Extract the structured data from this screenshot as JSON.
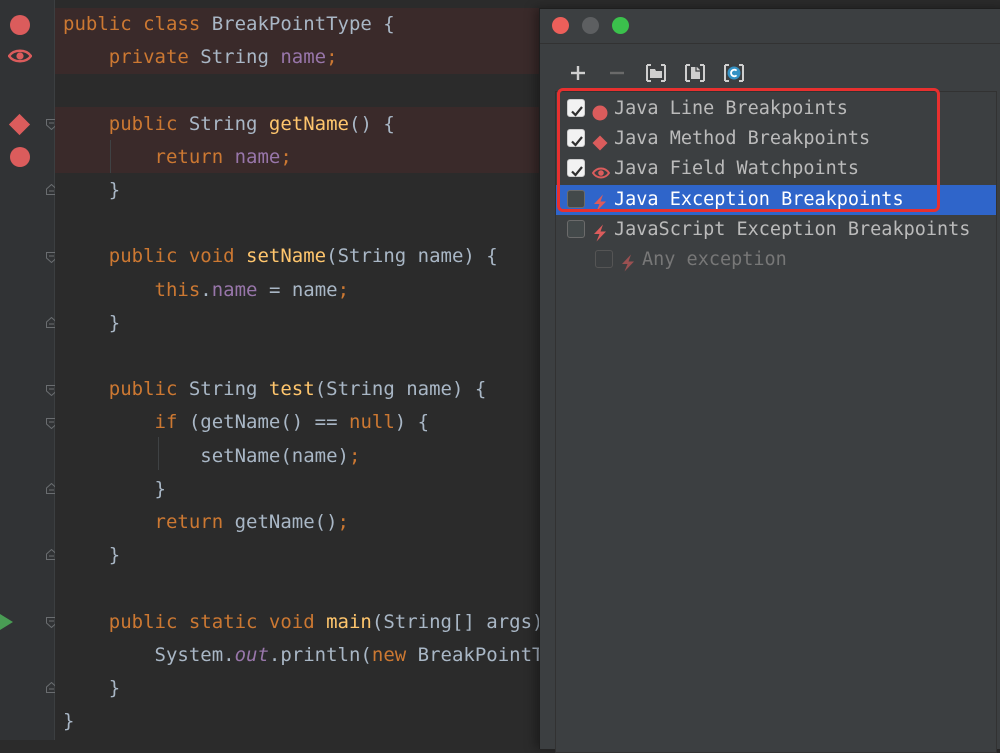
{
  "editor": {
    "lines": [
      {
        "tokens": [
          [
            "kw",
            "public class "
          ],
          [
            "",
            "BreakPointType {"
          ]
        ]
      },
      {
        "tokens": [
          [
            "",
            "    "
          ],
          [
            "kw",
            "private "
          ],
          [
            "",
            "String "
          ],
          [
            "fld",
            "name"
          ],
          [
            "kw",
            ";"
          ]
        ]
      },
      {
        "tokens": []
      },
      {
        "tokens": [
          [
            "",
            "    "
          ],
          [
            "kw",
            "public "
          ],
          [
            "",
            "String "
          ],
          [
            "fn",
            "getName"
          ],
          [
            "",
            "() {"
          ]
        ]
      },
      {
        "tokens": [
          [
            "",
            "        "
          ],
          [
            "kw",
            "return "
          ],
          [
            "fld",
            "name"
          ],
          [
            "kw",
            ";"
          ]
        ]
      },
      {
        "tokens": [
          [
            "",
            "    }"
          ]
        ]
      },
      {
        "tokens": []
      },
      {
        "tokens": [
          [
            "",
            "    "
          ],
          [
            "kw",
            "public void "
          ],
          [
            "fn",
            "setName"
          ],
          [
            "",
            "(String name) {"
          ]
        ]
      },
      {
        "tokens": [
          [
            "",
            "        "
          ],
          [
            "kw",
            "this"
          ],
          [
            "",
            "."
          ],
          [
            "fld",
            "name"
          ],
          [
            "",
            " = name"
          ],
          [
            "kw",
            ";"
          ]
        ]
      },
      {
        "tokens": [
          [
            "",
            "    }"
          ]
        ]
      },
      {
        "tokens": []
      },
      {
        "tokens": [
          [
            "",
            "    "
          ],
          [
            "kw",
            "public "
          ],
          [
            "",
            "String "
          ],
          [
            "fn",
            "test"
          ],
          [
            "",
            "(String name) {"
          ]
        ]
      },
      {
        "tokens": [
          [
            "",
            "        "
          ],
          [
            "kw",
            "if "
          ],
          [
            "",
            "(getName() == "
          ],
          [
            "kw",
            "null"
          ],
          [
            "",
            ") {"
          ]
        ]
      },
      {
        "tokens": [
          [
            "",
            "            setName(name)"
          ],
          [
            "kw",
            ";"
          ]
        ]
      },
      {
        "tokens": [
          [
            "",
            "        }"
          ]
        ]
      },
      {
        "tokens": [
          [
            "",
            "        "
          ],
          [
            "kw",
            "return "
          ],
          [
            "",
            "getName()"
          ],
          [
            "kw",
            ";"
          ]
        ]
      },
      {
        "tokens": [
          [
            "",
            "    }"
          ]
        ]
      },
      {
        "tokens": []
      },
      {
        "tokens": [
          [
            "",
            "    "
          ],
          [
            "kw",
            "public static void "
          ],
          [
            "fn",
            "main"
          ],
          [
            "",
            "(String[] args) {"
          ]
        ]
      },
      {
        "tokens": [
          [
            "",
            "        System."
          ],
          [
            "fld-i",
            "out"
          ],
          [
            "",
            ".println("
          ],
          [
            "kw",
            "new "
          ],
          [
            "",
            "BreakPointType()"
          ]
        ]
      },
      {
        "tokens": [
          [
            "",
            "    }"
          ]
        ]
      },
      {
        "tokens": [
          [
            "",
            "}"
          ]
        ]
      }
    ]
  },
  "dialog": {
    "toolbar": {
      "add_icon": "plus-icon",
      "remove_icon": "minus-icon",
      "group_by_package_icon": "folder-icon",
      "group_by_file_icon": "file-icon",
      "group_by_class_icon": "class-icon"
    },
    "breakpoint_types": [
      {
        "label": "Java Line Breakpoints",
        "checked": true,
        "icon": "breakpoint-dot-icon",
        "selected": false,
        "indent": 0
      },
      {
        "label": "Java Method Breakpoints",
        "checked": true,
        "icon": "method-breakpoint-icon",
        "selected": false,
        "indent": 0
      },
      {
        "label": "Java Field Watchpoints",
        "checked": true,
        "icon": "field-watchpoint-icon",
        "selected": false,
        "indent": 0
      },
      {
        "label": "Java Exception Breakpoints",
        "checked": false,
        "icon": "exception-breakpoint-icon",
        "selected": true,
        "indent": 0
      },
      {
        "label": "JavaScript Exception Breakpoints",
        "checked": false,
        "icon": "exception-breakpoint-icon",
        "selected": false,
        "indent": 0
      },
      {
        "label": "Any exception",
        "checked": false,
        "icon": "exception-breakpoint-icon",
        "selected": false,
        "indent": 1,
        "disabled": true
      }
    ]
  },
  "colors": {
    "breakpoint_red": "#db5c5c",
    "selection_blue": "#2f65ca",
    "callout_red": "#e8302f",
    "run_green": "#499c54"
  }
}
